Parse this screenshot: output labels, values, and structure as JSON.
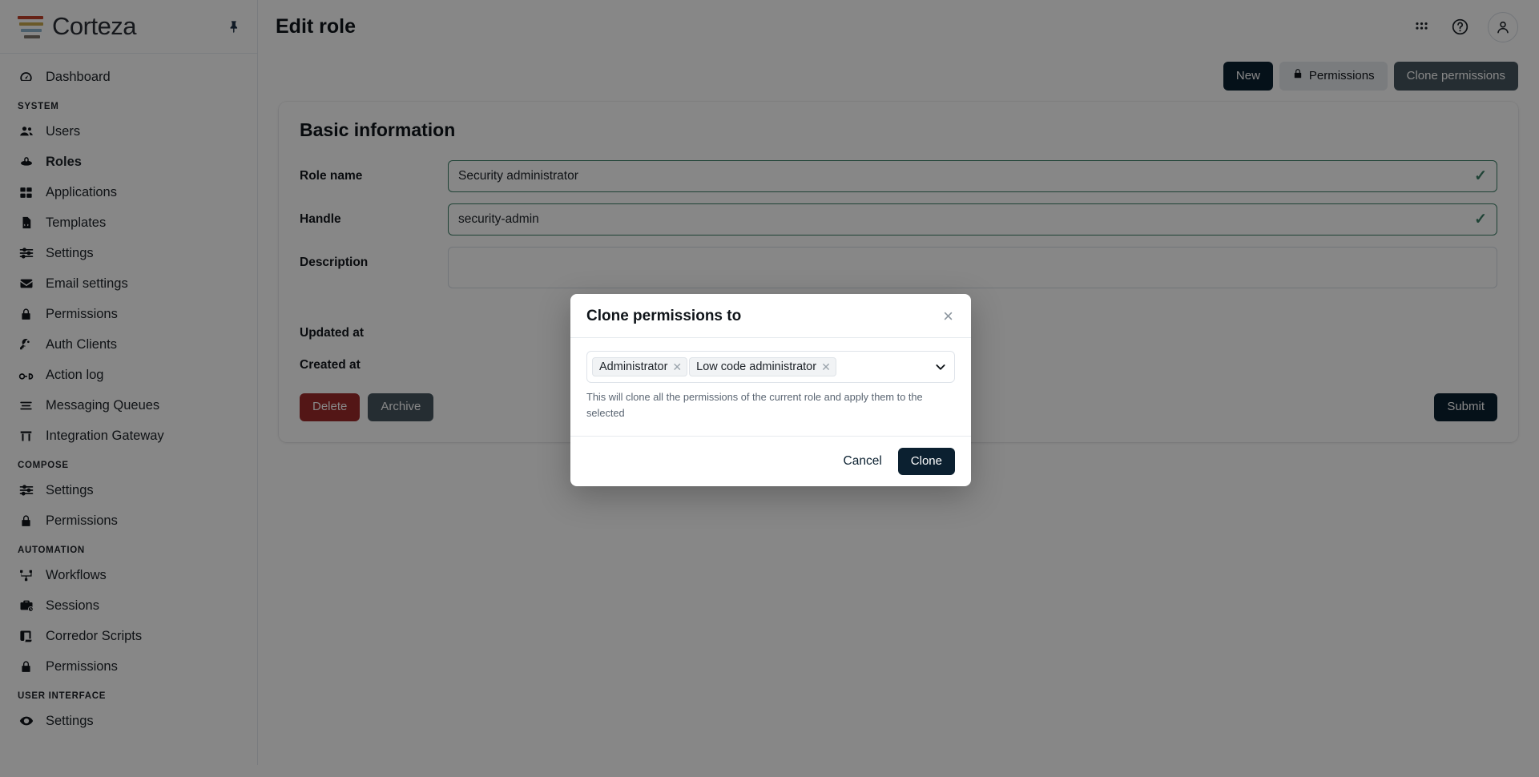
{
  "brand": {
    "name": "Corteza",
    "pin_icon": "pin-icon"
  },
  "sidebar": {
    "groups": [
      {
        "label": "",
        "items": [
          {
            "label": "Dashboard",
            "icon": "dashboard-icon",
            "active": false
          }
        ]
      },
      {
        "label": "SYSTEM",
        "items": [
          {
            "label": "Users",
            "icon": "users-icon",
            "active": false
          },
          {
            "label": "Roles",
            "icon": "roles-icon",
            "active": true
          },
          {
            "label": "Applications",
            "icon": "applications-icon",
            "active": false
          },
          {
            "label": "Templates",
            "icon": "templates-icon",
            "active": false
          },
          {
            "label": "Settings",
            "icon": "sliders-icon",
            "active": false
          },
          {
            "label": "Email settings",
            "icon": "envelope-icon",
            "active": false
          },
          {
            "label": "Permissions",
            "icon": "lock-icon",
            "active": false
          },
          {
            "label": "Auth Clients",
            "icon": "key-icon",
            "active": false
          },
          {
            "label": "Action log",
            "icon": "glasses-icon",
            "active": false
          },
          {
            "label": "Messaging Queues",
            "icon": "queue-icon",
            "active": false
          },
          {
            "label": "Integration Gateway",
            "icon": "gateway-icon",
            "active": false
          }
        ]
      },
      {
        "label": "COMPOSE",
        "items": [
          {
            "label": "Settings",
            "icon": "sliders-icon",
            "active": false
          },
          {
            "label": "Permissions",
            "icon": "lock-icon",
            "active": false
          }
        ]
      },
      {
        "label": "AUTOMATION",
        "items": [
          {
            "label": "Workflows",
            "icon": "workflow-icon",
            "active": false
          },
          {
            "label": "Sessions",
            "icon": "sessions-icon",
            "active": false
          },
          {
            "label": "Corredor Scripts",
            "icon": "script-icon",
            "active": false
          },
          {
            "label": "Permissions",
            "icon": "lock-icon",
            "active": false
          }
        ]
      },
      {
        "label": "USER INTERFACE",
        "items": [
          {
            "label": "Settings",
            "icon": "eye-icon",
            "active": false
          }
        ]
      }
    ]
  },
  "topbar": {
    "title": "Edit role",
    "icons": [
      "grid-apps-icon",
      "help-circle-icon",
      "user-avatar-icon"
    ]
  },
  "actions": {
    "new_label": "New",
    "permissions_label": "Permissions",
    "permissions_icon": "lock-icon",
    "clone_permissions_label": "Clone permissions"
  },
  "form": {
    "card_title": "Basic information",
    "role_name": {
      "label": "Role name",
      "value": "Security administrator",
      "valid": true,
      "check_icon": "check-icon"
    },
    "handle": {
      "label": "Handle",
      "value": "security-admin",
      "valid": true,
      "check_icon": "check-icon"
    },
    "description": {
      "label": "Description",
      "value": "",
      "placeholder": ""
    },
    "updated_at": {
      "label": "Updated at",
      "value": ""
    },
    "created_at": {
      "label": "Created at",
      "value": ""
    },
    "delete_label": "Delete",
    "archive_label": "Archive",
    "submit_label": "Submit"
  },
  "modal": {
    "title": "Clone permissions to",
    "close_icon": "close-icon",
    "caret_icon": "chevron-down-icon",
    "selected_roles": [
      {
        "label": "Administrator",
        "remove_icon": "remove-tag-icon"
      },
      {
        "label": "Low code administrator",
        "remove_icon": "remove-tag-icon"
      }
    ],
    "hint": "This will clone all the permissions of the current role and apply them to the selected",
    "cancel_label": "Cancel",
    "clone_label": "Clone"
  },
  "colors": {
    "brand_dark": "#0b2030",
    "danger": "#9e2a2a",
    "slate": "#46565f",
    "valid_green": "#3c7f66",
    "logo_red": "#c0402b",
    "logo_yellow": "#c9a94e",
    "logo_blue": "#8fb4cc",
    "logo_gray": "#7d756c"
  }
}
